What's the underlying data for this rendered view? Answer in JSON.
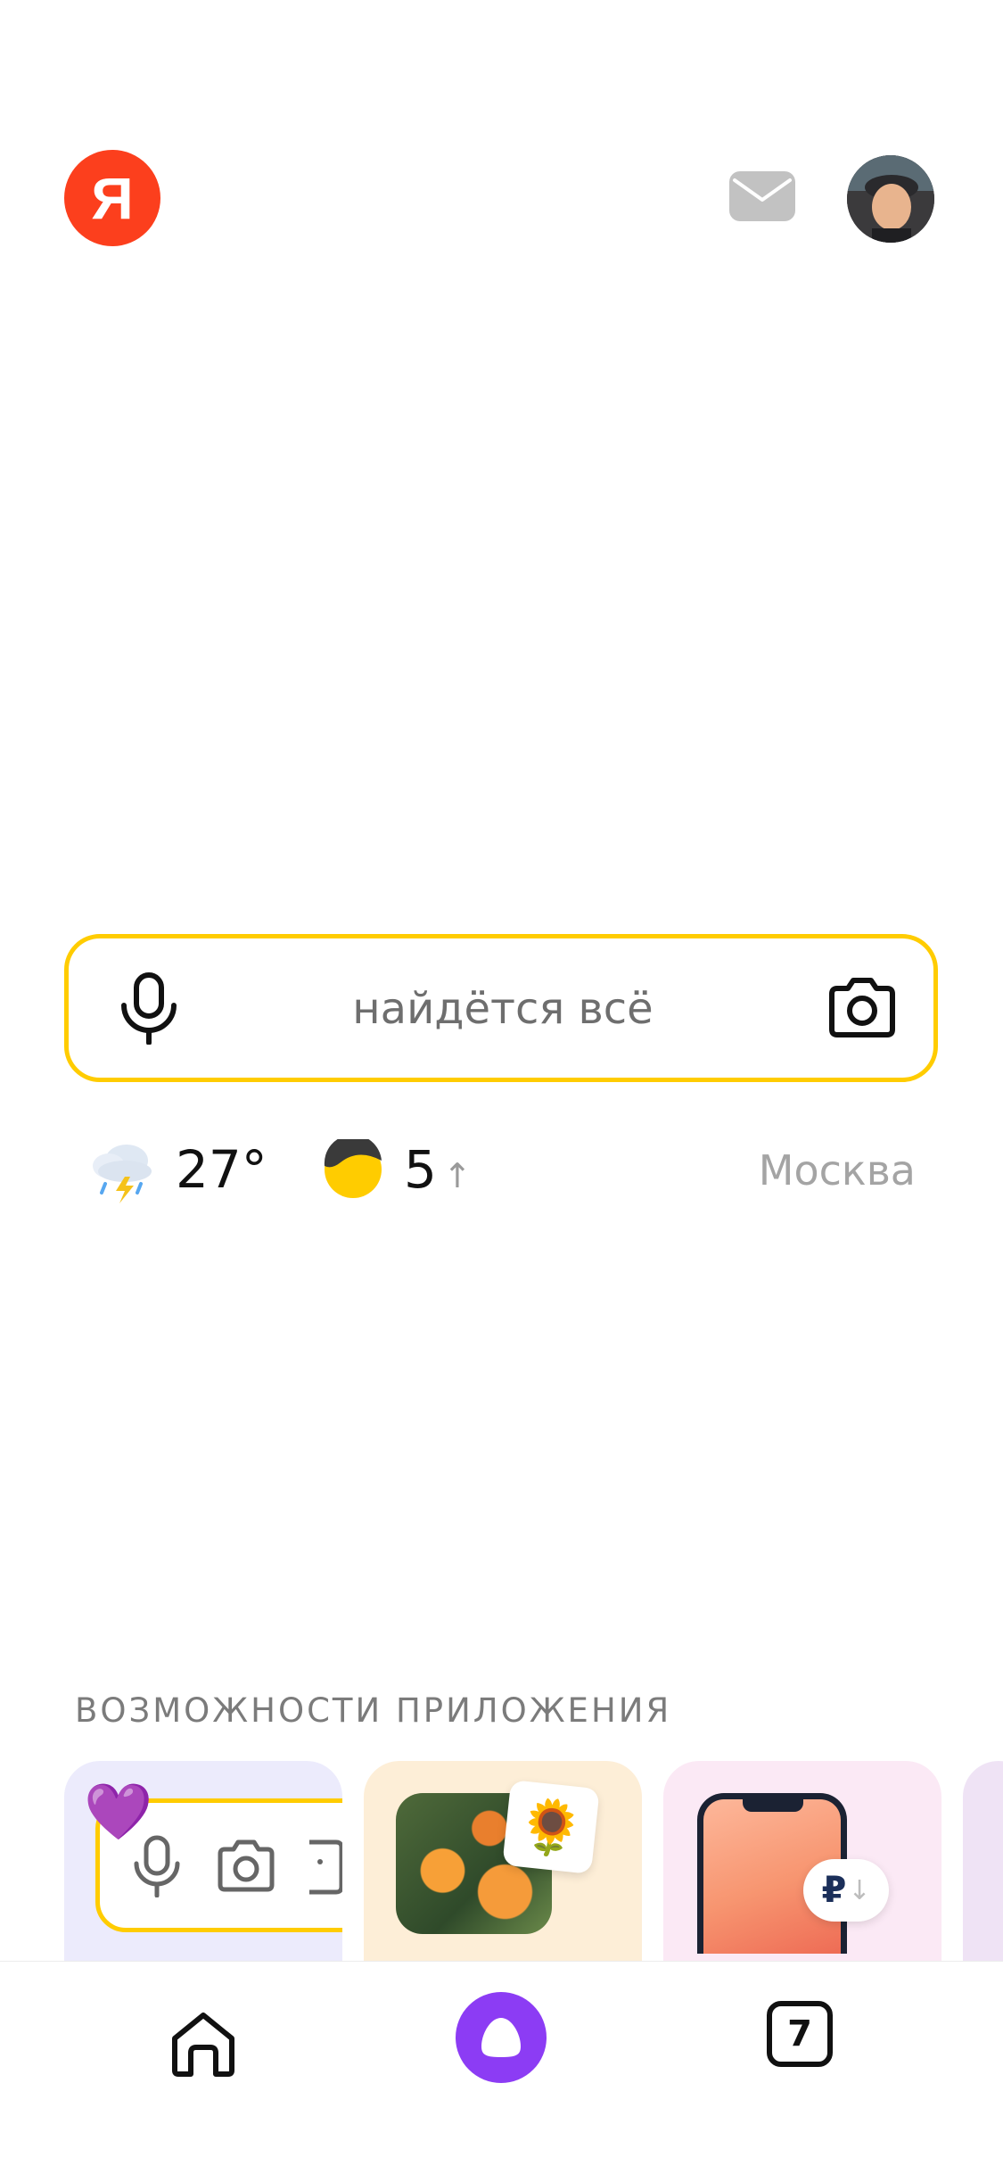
{
  "header": {
    "logo_letter": "Я",
    "mail_icon": "mail-icon",
    "avatar_icon": "user-avatar"
  },
  "search": {
    "placeholder": "найдётся всё",
    "mic_icon": "microphone-icon",
    "camera_icon": "camera-icon"
  },
  "info": {
    "weather_icon": "thunderstorm-icon",
    "temperature": "27°",
    "traffic_icon": "traffic-icon",
    "traffic_level": "5",
    "traffic_trend": "↑",
    "city": "Москва"
  },
  "features": {
    "title": "ВОЗМОЖНОСТИ ПРИЛОЖЕНИЯ",
    "cards": [
      {
        "icon": "heart-icon"
      },
      {
        "icon": "sunflower-sticker-icon"
      },
      {
        "icon": "ruble-down-icon",
        "badge": "₽",
        "badge_arrow": "↓"
      },
      {
        "icon": "partial-card"
      }
    ]
  },
  "bottom_nav": {
    "home_icon": "home-icon",
    "alice_icon": "alice-icon",
    "tabs_count": "7"
  },
  "colors": {
    "accent_yellow": "#ffcc00",
    "logo_red": "#fc3f1d",
    "alice_purple": "#8c3cf4"
  }
}
